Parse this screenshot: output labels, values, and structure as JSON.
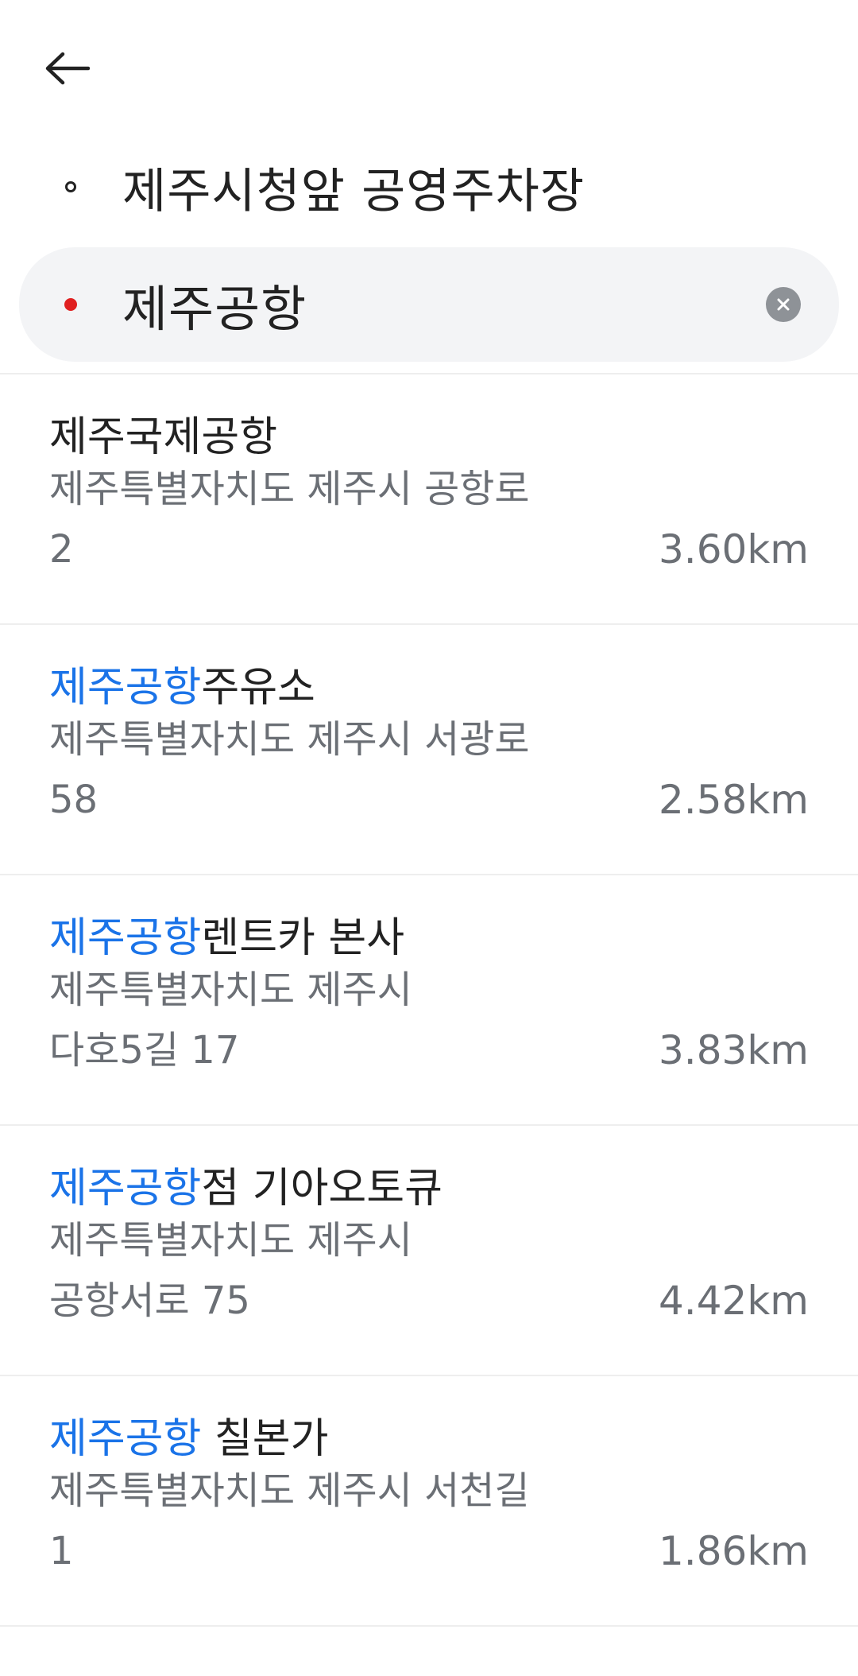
{
  "header": {
    "back_icon": "arrow-left-icon"
  },
  "route": {
    "origin": "제주시청앞 공영주차장",
    "destination": "제주공항",
    "clear_icon": "close-circle-icon",
    "destination_dot_color": "#e02020"
  },
  "results": [
    {
      "highlight": "",
      "title": "제주국제공항",
      "address_line1": "제주특별자치도 제주시 공항로",
      "address_line2": "2",
      "distance": "3.60km"
    },
    {
      "highlight": "제주공항",
      "title": "주유소",
      "address_line1": "제주특별자치도 제주시 서광로",
      "address_line2": "58",
      "distance": "2.58km"
    },
    {
      "highlight": "제주공항",
      "title": "렌트카 본사",
      "address_line1": "제주특별자치도 제주시",
      "address_line2": "다호5길 17",
      "distance": "3.83km"
    },
    {
      "highlight": "제주공항",
      "title": "점 기아오토큐",
      "address_line1": "제주특별자치도 제주시",
      "address_line2": "공항서로 75",
      "distance": "4.42km"
    },
    {
      "highlight": "제주공항",
      "title": " 칠본가",
      "address_line1": "제주특별자치도 제주시 서천길",
      "address_line2": "1",
      "distance": "1.86km"
    }
  ],
  "colors": {
    "highlight": "#1a73e8",
    "text": "#222222",
    "secondary": "#6b6f75"
  }
}
